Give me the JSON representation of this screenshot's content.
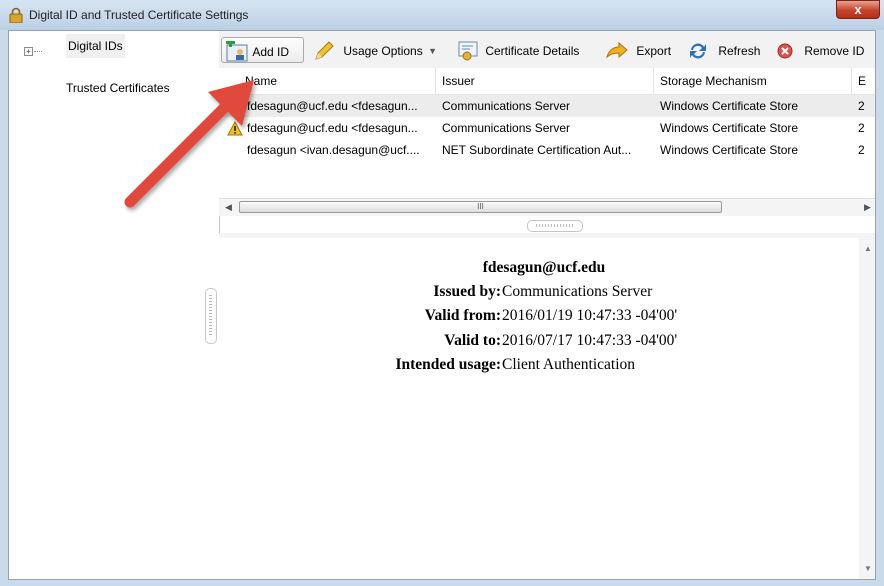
{
  "window": {
    "title": "Digital ID and Trusted Certificate Settings",
    "close_label": "x"
  },
  "tree": {
    "expander": "+",
    "items": [
      {
        "label": "Digital IDs"
      },
      {
        "label": "Trusted Certificates"
      }
    ]
  },
  "toolbar": {
    "add_id": "Add ID",
    "usage_options": "Usage Options",
    "certificate_details": "Certificate Details",
    "export": "Export",
    "refresh": "Refresh",
    "remove_id": "Remove ID"
  },
  "table": {
    "columns": [
      "Name",
      "Issuer",
      "Storage Mechanism",
      "E"
    ],
    "rows": [
      {
        "name": "fdesagun@ucf.edu <fdesagun...",
        "issuer": "Communications Server",
        "storage": "Windows Certificate Store",
        "e": "2",
        "warning": false,
        "selected": true
      },
      {
        "name": "fdesagun@ucf.edu <fdesagun...",
        "issuer": "Communications Server",
        "storage": "Windows Certificate Store",
        "e": "2",
        "warning": true,
        "selected": false
      },
      {
        "name": "fdesagun <ivan.desagun@ucf....",
        "issuer": "NET Subordinate Certification Aut...",
        "storage": "Windows Certificate Store",
        "e": "2",
        "warning": false,
        "selected": false
      }
    ],
    "scroll_grip": "III"
  },
  "details": {
    "name": "fdesagun@ucf.edu",
    "issued_by_label": "Issued by:",
    "issued_by": "Communications Server",
    "valid_from_label": "Valid from:",
    "valid_from": "2016/01/19 10:47:33 -04'00'",
    "valid_to_label": "Valid to:",
    "valid_to": "2016/07/17 10:47:33 -04'00'",
    "usage_label": "Intended usage:",
    "usage": "Client Authentication"
  },
  "colors": {
    "arrow": "#e0483a",
    "title_bar": "#c6d8ec",
    "close_button": "#c7432a"
  }
}
